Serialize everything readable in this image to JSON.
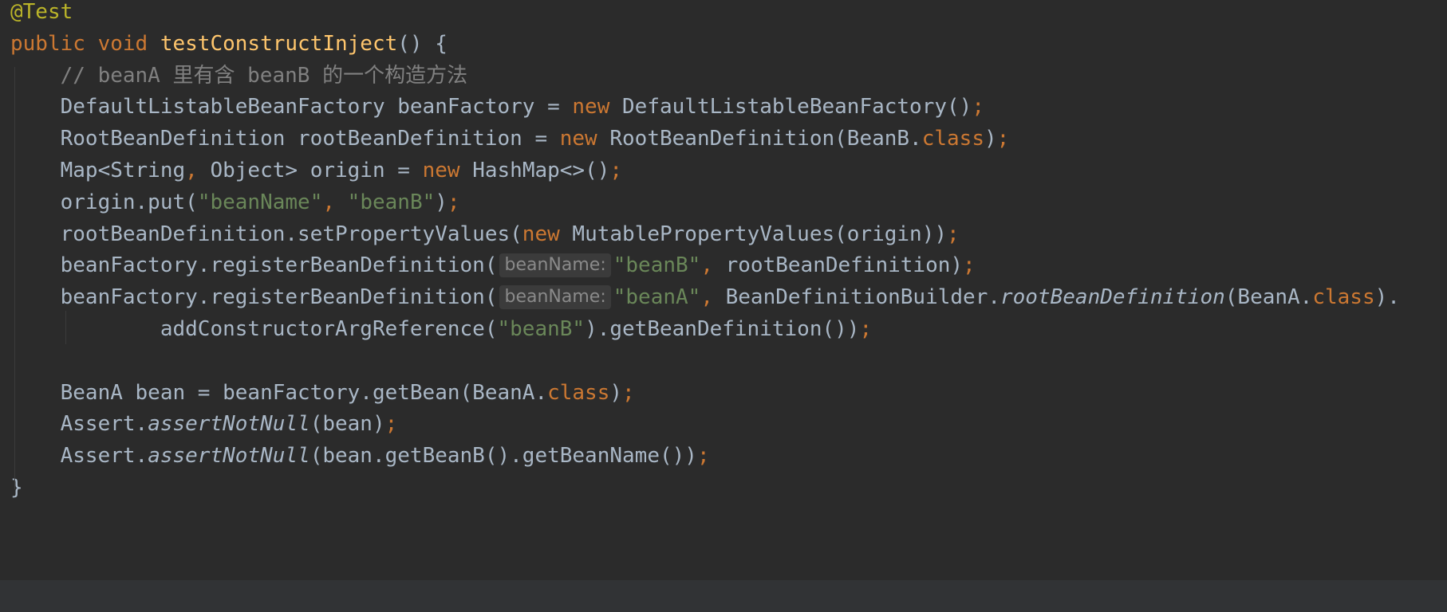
{
  "editor": {
    "theme_colors": {
      "background": "#2b2b2b",
      "plain": "#a9b7c6",
      "keyword": "#cc7832",
      "method": "#ffc66d",
      "string": "#6a8759",
      "comment": "#808080",
      "annotation": "#bbb529",
      "param_hint_bg": "#3b3b3b"
    },
    "lines": [
      [
        {
          "t": "@Test",
          "c": "annotation"
        }
      ],
      [
        {
          "t": "public void ",
          "c": "keyword"
        },
        {
          "t": "testConstructInject",
          "c": "method"
        },
        {
          "t": "() {",
          "c": "plain"
        }
      ],
      [
        {
          "t": "    // beanA 里有含 beanB 的一个构造方法",
          "c": "comment"
        }
      ],
      [
        {
          "t": "    DefaultListableBeanFactory beanFactory = ",
          "c": "plain"
        },
        {
          "t": "new ",
          "c": "keyword"
        },
        {
          "t": "DefaultListableBeanFactory()",
          "c": "plain"
        },
        {
          "t": ";",
          "c": "keyword"
        }
      ],
      [
        {
          "t": "    RootBeanDefinition rootBeanDefinition = ",
          "c": "plain"
        },
        {
          "t": "new ",
          "c": "keyword"
        },
        {
          "t": "RootBeanDefinition(BeanB.",
          "c": "plain"
        },
        {
          "t": "class",
          "c": "keyword"
        },
        {
          "t": ")",
          "c": "plain"
        },
        {
          "t": ";",
          "c": "keyword"
        }
      ],
      [
        {
          "t": "    Map<String",
          "c": "plain"
        },
        {
          "t": ", ",
          "c": "keyword"
        },
        {
          "t": "Object> origin = ",
          "c": "plain"
        },
        {
          "t": "new ",
          "c": "keyword"
        },
        {
          "t": "HashMap<>()",
          "c": "plain"
        },
        {
          "t": ";",
          "c": "keyword"
        }
      ],
      [
        {
          "t": "    origin.put(",
          "c": "plain"
        },
        {
          "t": "\"beanName\"",
          "c": "string"
        },
        {
          "t": ", ",
          "c": "keyword"
        },
        {
          "t": "\"beanB\"",
          "c": "string"
        },
        {
          "t": ")",
          "c": "plain"
        },
        {
          "t": ";",
          "c": "keyword"
        }
      ],
      [
        {
          "t": "    rootBeanDefinition.setPropertyValues(",
          "c": "plain"
        },
        {
          "t": "new ",
          "c": "keyword"
        },
        {
          "t": "MutablePropertyValues(origin))",
          "c": "plain"
        },
        {
          "t": ";",
          "c": "keyword"
        }
      ],
      [
        {
          "t": "    beanFactory.registerBeanDefinition(",
          "c": "plain"
        },
        {
          "t": "beanName:",
          "c": "hint"
        },
        {
          "t": "\"beanB\"",
          "c": "string"
        },
        {
          "t": ", ",
          "c": "keyword"
        },
        {
          "t": "rootBeanDefinition)",
          "c": "plain"
        },
        {
          "t": ";",
          "c": "keyword"
        }
      ],
      [
        {
          "t": "    beanFactory.registerBeanDefinition(",
          "c": "plain"
        },
        {
          "t": "beanName:",
          "c": "hint"
        },
        {
          "t": "\"beanA\"",
          "c": "string"
        },
        {
          "t": ", ",
          "c": "keyword"
        },
        {
          "t": "BeanDefinitionBuilder.",
          "c": "plain"
        },
        {
          "t": "rootBeanDefinition",
          "c": "static"
        },
        {
          "t": "(BeanA.",
          "c": "plain"
        },
        {
          "t": "class",
          "c": "keyword"
        },
        {
          "t": ").",
          "c": "plain"
        }
      ],
      [
        {
          "t": "            addConstructorArgReference(",
          "c": "plain"
        },
        {
          "t": "\"beanB\"",
          "c": "string"
        },
        {
          "t": ").getBeanDefinition())",
          "c": "plain"
        },
        {
          "t": ";",
          "c": "keyword"
        }
      ],
      [],
      [
        {
          "t": "    BeanA bean = beanFactory.getBean(BeanA.",
          "c": "plain"
        },
        {
          "t": "class",
          "c": "keyword"
        },
        {
          "t": ")",
          "c": "plain"
        },
        {
          "t": ";",
          "c": "keyword"
        }
      ],
      [
        {
          "t": "    Assert.",
          "c": "plain"
        },
        {
          "t": "assertNotNull",
          "c": "static"
        },
        {
          "t": "(bean)",
          "c": "plain"
        },
        {
          "t": ";",
          "c": "keyword"
        }
      ],
      [
        {
          "t": "    Assert.",
          "c": "plain"
        },
        {
          "t": "assertNotNull",
          "c": "static"
        },
        {
          "t": "(bean.getBeanB().getBeanName())",
          "c": "plain"
        },
        {
          "t": ";",
          "c": "keyword"
        }
      ],
      [
        {
          "t": "}",
          "c": "plain"
        }
      ]
    ]
  }
}
